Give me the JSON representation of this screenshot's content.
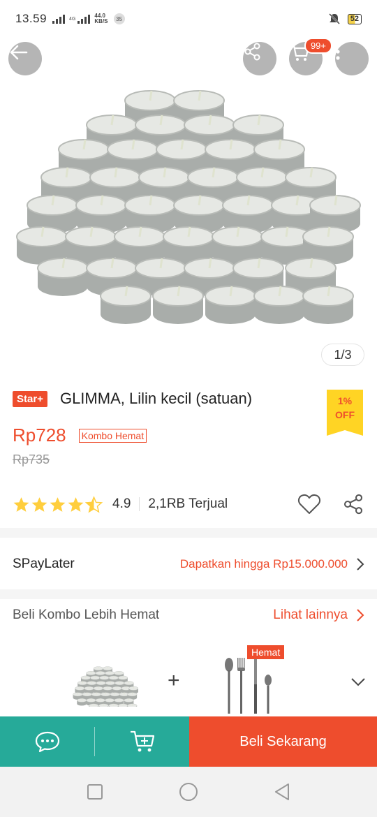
{
  "status": {
    "time": "13.59",
    "network": "4G",
    "speed_value": "44.0",
    "speed_unit": "KB/S",
    "notif_count": "35",
    "battery": "52"
  },
  "header": {
    "back_icon": "arrow-left-icon",
    "share_icon": "share-icon",
    "cart_icon": "cart-icon",
    "cart_badge": "99+",
    "more_icon": "more-vertical-icon"
  },
  "gallery": {
    "pager": "1/3"
  },
  "product": {
    "badge": "Star+",
    "title": "GLIMMA, Lilin kecil (satuan)",
    "price": "Rp728",
    "combo_tag": "Kombo Hemat",
    "old_price": "Rp735",
    "discount_percent": "1%",
    "discount_label": "OFF",
    "rating": "4.9",
    "rating_stars": 4.5,
    "sold": "2,1RB Terjual"
  },
  "spaylater": {
    "label": "SPayLater",
    "offer": "Dapatkan hingga Rp15.000.000"
  },
  "combo": {
    "title": "Beli Kombo Lebih Hemat",
    "more": "Lihat lainnya",
    "plus": "+",
    "tag": "Hemat"
  },
  "bottom": {
    "buy_now": "Beli Sekarang"
  },
  "colors": {
    "accent": "#ee4d2d",
    "teal": "#26aa99",
    "star": "#ffce3d",
    "badge_yellow": "#ffd424"
  }
}
